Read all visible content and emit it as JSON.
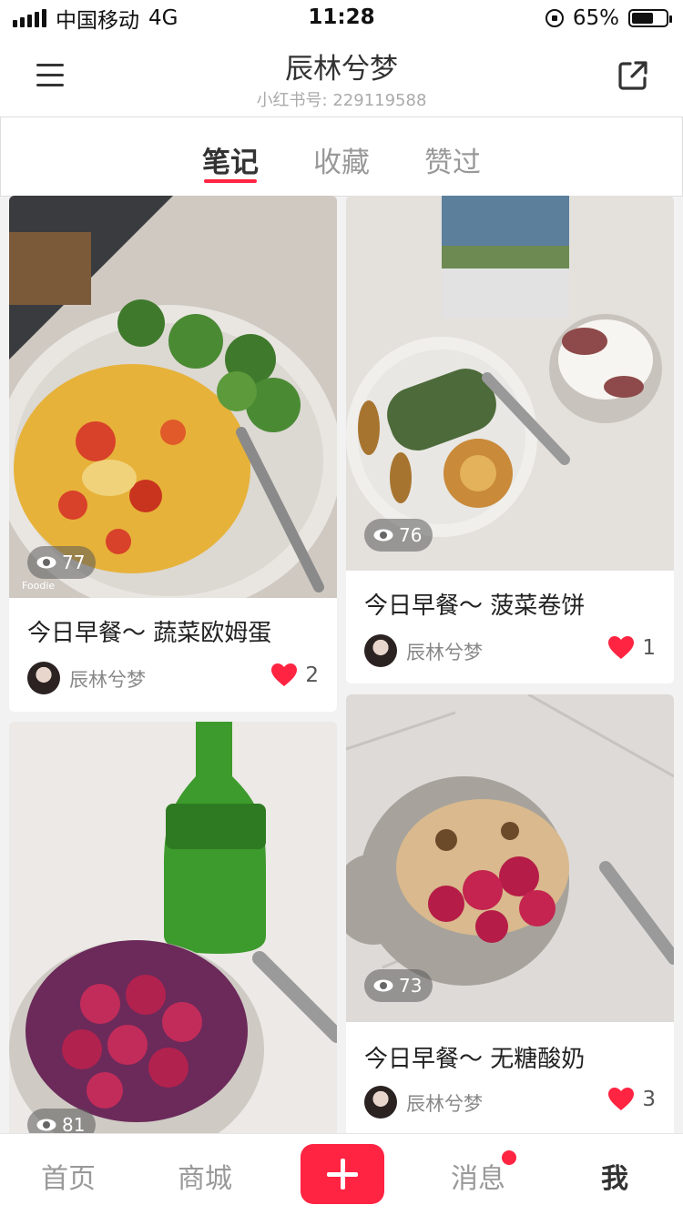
{
  "status_bar": {
    "carrier": "中国移动",
    "network": "4G",
    "time": "11:28",
    "battery": "65%",
    "battery_level": 0.65
  },
  "header": {
    "title": "辰林兮梦",
    "subtitle": "小红书号: 229119588"
  },
  "tabs": [
    {
      "label": "笔记",
      "active": true
    },
    {
      "label": "收藏"
    },
    {
      "label": "赞过"
    }
  ],
  "notes": [
    {
      "views": "77",
      "title": "今日早餐～ 蔬菜欧姆蛋",
      "author": "辰林兮梦",
      "likes": "2",
      "photo_watermark": "Foodie"
    },
    {
      "views": "76",
      "title": "今日早餐～ 菠菜卷饼",
      "author": "辰林兮梦",
      "likes": "1"
    },
    {
      "views": "81"
    },
    {
      "views": "73",
      "title": "今日早餐～ 无糖酸奶",
      "author": "辰林兮梦",
      "likes": "3"
    }
  ],
  "bottom_nav": {
    "home": "首页",
    "mall": "商城",
    "messages": "消息",
    "me": "我"
  },
  "colors": {
    "accent": "#ff2442"
  },
  "icons": [
    "menu-icon",
    "share-icon",
    "eye-icon",
    "heart-icon",
    "plus-icon"
  ]
}
